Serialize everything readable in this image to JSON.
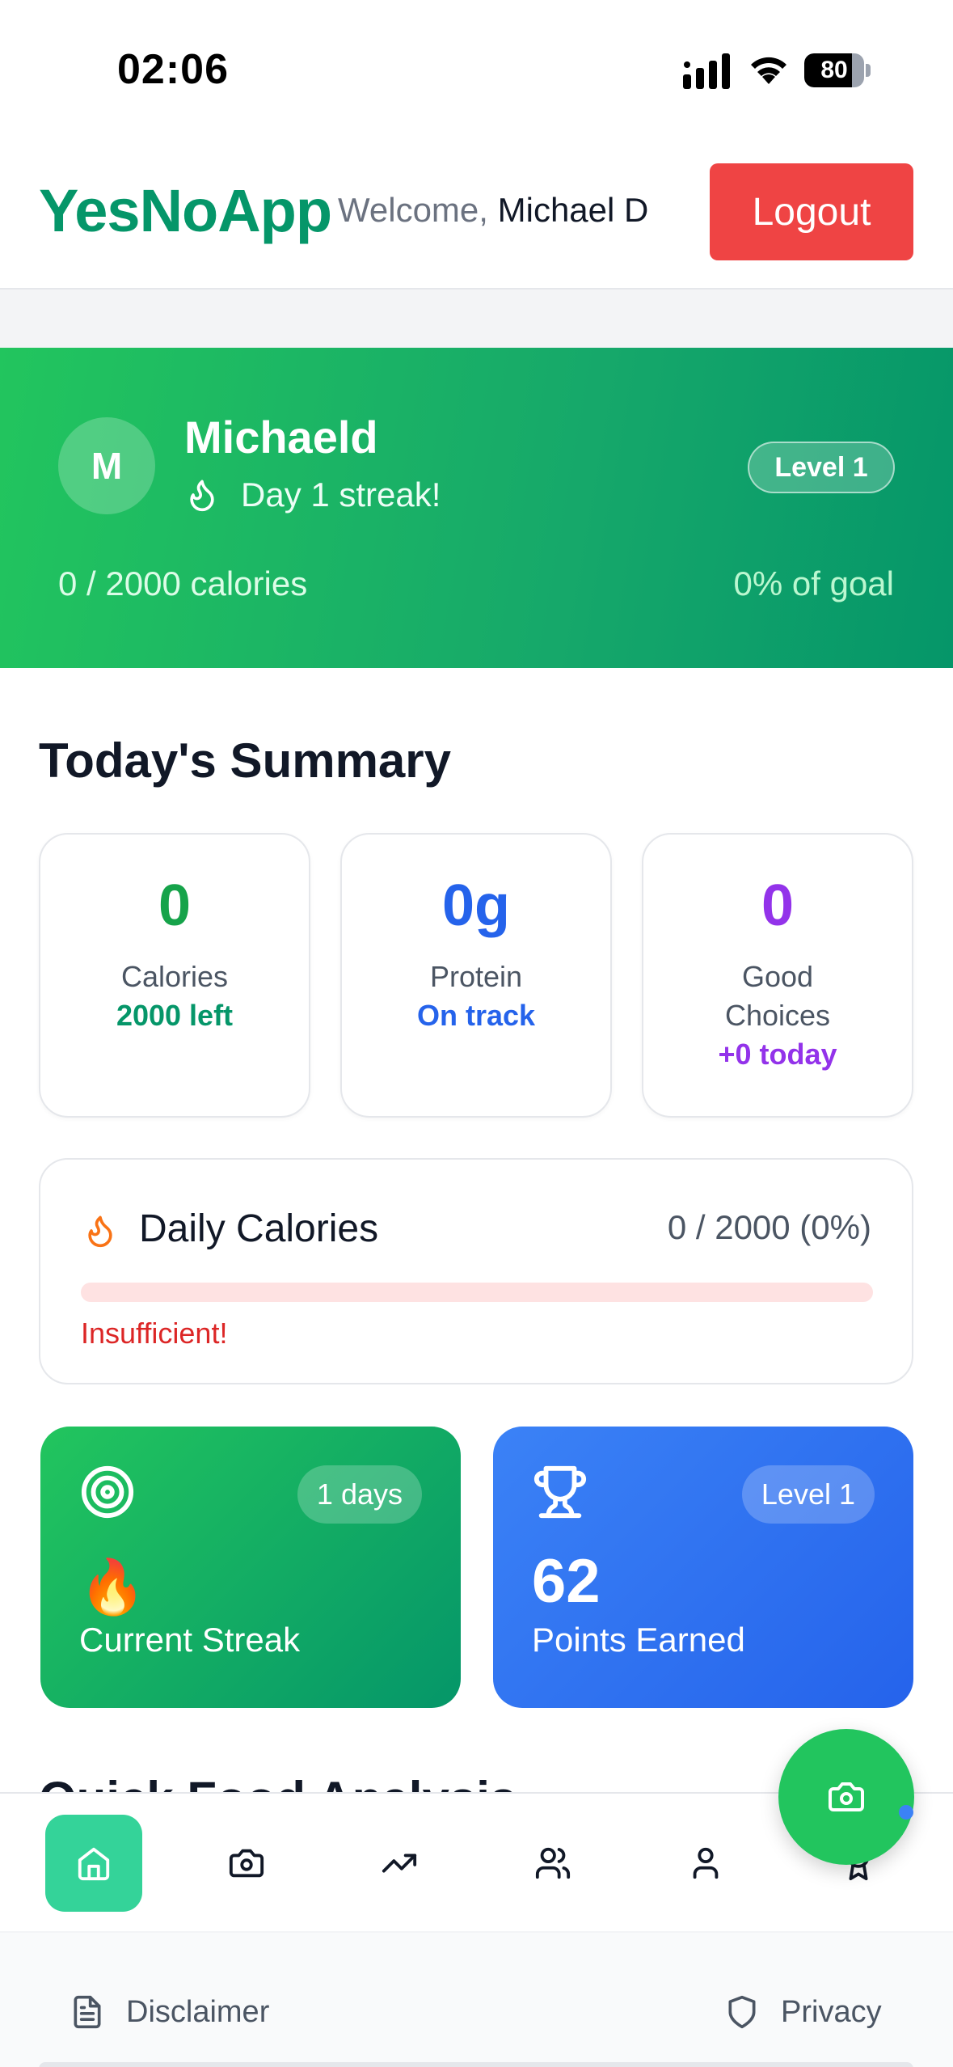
{
  "status_bar": {
    "time": "02:06",
    "battery": "80",
    "battery_level": 0.8
  },
  "header": {
    "brand": "YesNoApp",
    "welcome_prefix": "Welcome,",
    "user_name": "Michael D",
    "logout_label": "Logout"
  },
  "profile": {
    "avatar_initial": "M",
    "name": "Michaeld",
    "streak_text": "Day 1 streak!",
    "level": "Level 1",
    "calories_progress": "0 / 2000 calories",
    "goal_percent": "0% of goal"
  },
  "summary": {
    "title": "Today's Summary",
    "cards": [
      {
        "value": "0",
        "label": "Calories",
        "sub": "2000 left"
      },
      {
        "value": "0g",
        "label": "Protein",
        "sub": "On track"
      },
      {
        "value": "0",
        "label": "Good Choices",
        "sub": "+0 today"
      }
    ]
  },
  "daily_calories": {
    "title": "Daily Calories",
    "value": "0 / 2000 (0%)",
    "progress": 0,
    "status": "Insufficient!"
  },
  "tiles": {
    "streak": {
      "badge": "1 days",
      "emoji": "🔥",
      "label": "Current Streak"
    },
    "points": {
      "badge": "Level 1",
      "value": "62",
      "label": "Points Earned"
    }
  },
  "next_section": {
    "title": "Quick Food Analysis"
  },
  "nav": {
    "items": [
      "home-icon",
      "camera-icon",
      "trending-icon",
      "users-icon",
      "user-icon",
      "award-icon"
    ],
    "active": "home"
  },
  "fab": {
    "icon": "camera-icon"
  },
  "footer": {
    "disclaimer": "Disclaimer",
    "privacy": "Privacy"
  },
  "colors": {
    "brand": "#059669",
    "logout": "#ef4444",
    "hero_start": "#22c55e",
    "hero_end": "#059669",
    "protein": "#2563eb",
    "good_choices": "#9333ea",
    "alert": "#dc2626"
  }
}
